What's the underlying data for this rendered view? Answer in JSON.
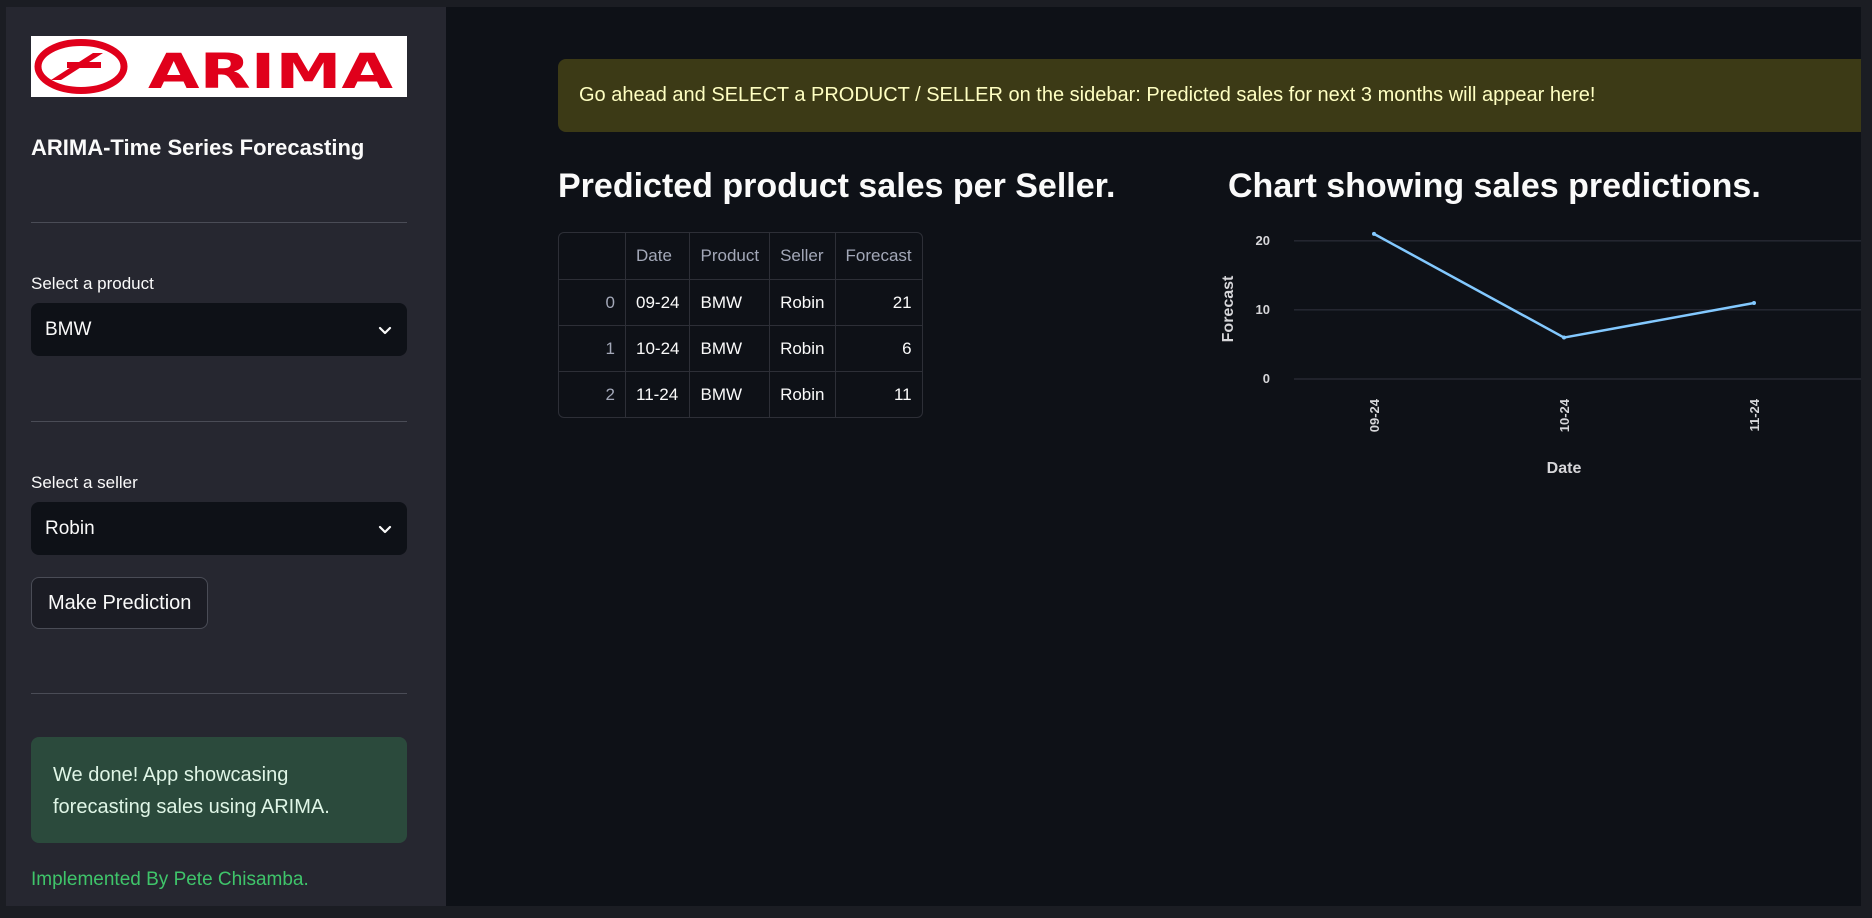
{
  "sidebar": {
    "logo_text": "ARIMA",
    "app_title": "ARIMA-Time Series Forecasting",
    "product_label": "Select a product",
    "product_value": "BMW",
    "seller_label": "Select a seller",
    "seller_value": "Robin",
    "predict_button": "Make Prediction",
    "success_message": "We done! App showcasing forecasting sales using ARIMA.",
    "credit": "Implemented By Pete Chisamba."
  },
  "main": {
    "banner": "Go ahead and SELECT a PRODUCT / SELLER on the sidebar: Predicted sales for next 3 months will appear here!",
    "table_title": "Predicted product sales per Seller.",
    "chart_title": "Chart showing sales predictions.",
    "table": {
      "columns": [
        "",
        "Date",
        "Product",
        "Seller",
        "Forecast"
      ],
      "rows": [
        [
          "0",
          "09-24",
          "BMW",
          "Robin",
          "21"
        ],
        [
          "1",
          "10-24",
          "BMW",
          "Robin",
          "6"
        ],
        [
          "2",
          "11-24",
          "BMW",
          "Robin",
          "11"
        ]
      ]
    }
  },
  "chart_data": {
    "type": "line",
    "x": [
      "09-24",
      "10-24",
      "11-24"
    ],
    "series": [
      {
        "values": [
          21,
          6,
          11
        ]
      }
    ],
    "xlabel": "Date",
    "ylabel": "Forecast",
    "yticks": [
      0,
      10,
      20
    ],
    "ylim": [
      0,
      22
    ],
    "grid": true,
    "line_color": "#83c9ff"
  },
  "colors": {
    "sidebar_bg": "#262730",
    "main_bg": "#0e1117",
    "warning_bg": "#3c3a16",
    "success_bg": "#2b4a3c",
    "logo_red": "#e0001b"
  }
}
